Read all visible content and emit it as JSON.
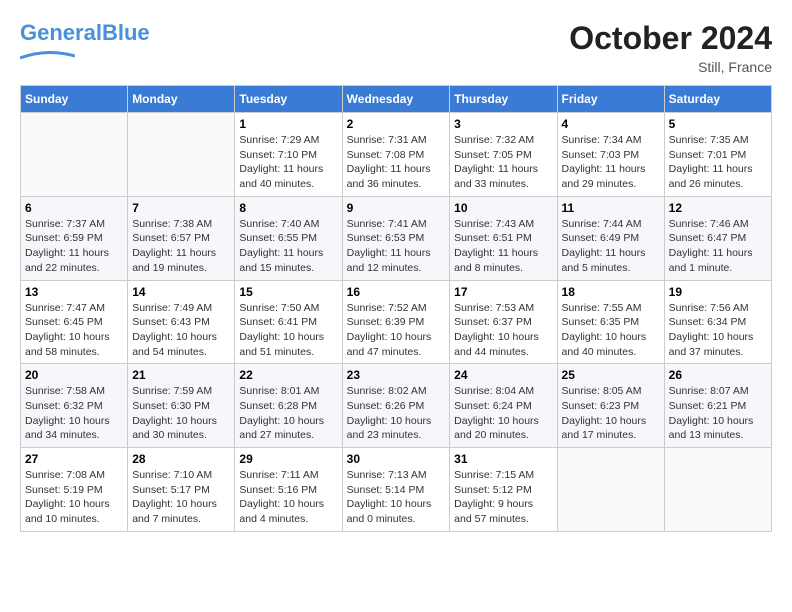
{
  "header": {
    "logo_general": "General",
    "logo_blue": "Blue",
    "month": "October 2024",
    "location": "Still, France"
  },
  "weekdays": [
    "Sunday",
    "Monday",
    "Tuesday",
    "Wednesday",
    "Thursday",
    "Friday",
    "Saturday"
  ],
  "weeks": [
    [
      {
        "day": "",
        "info": ""
      },
      {
        "day": "",
        "info": ""
      },
      {
        "day": "1",
        "info": "Sunrise: 7:29 AM\nSunset: 7:10 PM\nDaylight: 11 hours and 40 minutes."
      },
      {
        "day": "2",
        "info": "Sunrise: 7:31 AM\nSunset: 7:08 PM\nDaylight: 11 hours and 36 minutes."
      },
      {
        "day": "3",
        "info": "Sunrise: 7:32 AM\nSunset: 7:05 PM\nDaylight: 11 hours and 33 minutes."
      },
      {
        "day": "4",
        "info": "Sunrise: 7:34 AM\nSunset: 7:03 PM\nDaylight: 11 hours and 29 minutes."
      },
      {
        "day": "5",
        "info": "Sunrise: 7:35 AM\nSunset: 7:01 PM\nDaylight: 11 hours and 26 minutes."
      }
    ],
    [
      {
        "day": "6",
        "info": "Sunrise: 7:37 AM\nSunset: 6:59 PM\nDaylight: 11 hours and 22 minutes."
      },
      {
        "day": "7",
        "info": "Sunrise: 7:38 AM\nSunset: 6:57 PM\nDaylight: 11 hours and 19 minutes."
      },
      {
        "day": "8",
        "info": "Sunrise: 7:40 AM\nSunset: 6:55 PM\nDaylight: 11 hours and 15 minutes."
      },
      {
        "day": "9",
        "info": "Sunrise: 7:41 AM\nSunset: 6:53 PM\nDaylight: 11 hours and 12 minutes."
      },
      {
        "day": "10",
        "info": "Sunrise: 7:43 AM\nSunset: 6:51 PM\nDaylight: 11 hours and 8 minutes."
      },
      {
        "day": "11",
        "info": "Sunrise: 7:44 AM\nSunset: 6:49 PM\nDaylight: 11 hours and 5 minutes."
      },
      {
        "day": "12",
        "info": "Sunrise: 7:46 AM\nSunset: 6:47 PM\nDaylight: 11 hours and 1 minute."
      }
    ],
    [
      {
        "day": "13",
        "info": "Sunrise: 7:47 AM\nSunset: 6:45 PM\nDaylight: 10 hours and 58 minutes."
      },
      {
        "day": "14",
        "info": "Sunrise: 7:49 AM\nSunset: 6:43 PM\nDaylight: 10 hours and 54 minutes."
      },
      {
        "day": "15",
        "info": "Sunrise: 7:50 AM\nSunset: 6:41 PM\nDaylight: 10 hours and 51 minutes."
      },
      {
        "day": "16",
        "info": "Sunrise: 7:52 AM\nSunset: 6:39 PM\nDaylight: 10 hours and 47 minutes."
      },
      {
        "day": "17",
        "info": "Sunrise: 7:53 AM\nSunset: 6:37 PM\nDaylight: 10 hours and 44 minutes."
      },
      {
        "day": "18",
        "info": "Sunrise: 7:55 AM\nSunset: 6:35 PM\nDaylight: 10 hours and 40 minutes."
      },
      {
        "day": "19",
        "info": "Sunrise: 7:56 AM\nSunset: 6:34 PM\nDaylight: 10 hours and 37 minutes."
      }
    ],
    [
      {
        "day": "20",
        "info": "Sunrise: 7:58 AM\nSunset: 6:32 PM\nDaylight: 10 hours and 34 minutes."
      },
      {
        "day": "21",
        "info": "Sunrise: 7:59 AM\nSunset: 6:30 PM\nDaylight: 10 hours and 30 minutes."
      },
      {
        "day": "22",
        "info": "Sunrise: 8:01 AM\nSunset: 6:28 PM\nDaylight: 10 hours and 27 minutes."
      },
      {
        "day": "23",
        "info": "Sunrise: 8:02 AM\nSunset: 6:26 PM\nDaylight: 10 hours and 23 minutes."
      },
      {
        "day": "24",
        "info": "Sunrise: 8:04 AM\nSunset: 6:24 PM\nDaylight: 10 hours and 20 minutes."
      },
      {
        "day": "25",
        "info": "Sunrise: 8:05 AM\nSunset: 6:23 PM\nDaylight: 10 hours and 17 minutes."
      },
      {
        "day": "26",
        "info": "Sunrise: 8:07 AM\nSunset: 6:21 PM\nDaylight: 10 hours and 13 minutes."
      }
    ],
    [
      {
        "day": "27",
        "info": "Sunrise: 7:08 AM\nSunset: 5:19 PM\nDaylight: 10 hours and 10 minutes."
      },
      {
        "day": "28",
        "info": "Sunrise: 7:10 AM\nSunset: 5:17 PM\nDaylight: 10 hours and 7 minutes."
      },
      {
        "day": "29",
        "info": "Sunrise: 7:11 AM\nSunset: 5:16 PM\nDaylight: 10 hours and 4 minutes."
      },
      {
        "day": "30",
        "info": "Sunrise: 7:13 AM\nSunset: 5:14 PM\nDaylight: 10 hours and 0 minutes."
      },
      {
        "day": "31",
        "info": "Sunrise: 7:15 AM\nSunset: 5:12 PM\nDaylight: 9 hours and 57 minutes."
      },
      {
        "day": "",
        "info": ""
      },
      {
        "day": "",
        "info": ""
      }
    ]
  ]
}
